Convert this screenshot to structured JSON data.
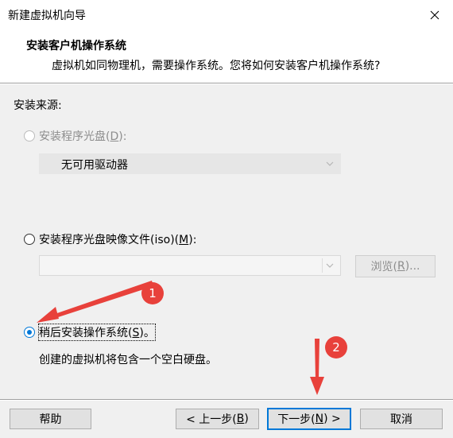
{
  "window": {
    "title": "新建虚拟机向导"
  },
  "header": {
    "title": "安装客户机操作系统",
    "subtitle": "虚拟机如同物理机，需要操作系统。您将如何安装客户机操作系统?"
  },
  "source": {
    "group_label": "安装来源:",
    "option_disc": {
      "text": "安装程序光盘(",
      "key": "D",
      "tail": "):",
      "state": "disabled"
    },
    "disc_combo": {
      "value": "无可用驱动器"
    },
    "option_iso": {
      "text": "安装程序光盘映像文件(iso)(",
      "key": "M",
      "tail": "):"
    },
    "iso_combo": {
      "value": ""
    },
    "browse": {
      "text": "浏览(",
      "key": "R",
      "tail": ")..."
    },
    "option_later": {
      "text": "稍后安装操作系统(",
      "key": "S",
      "tail": ")。",
      "checked": true
    },
    "description": "创建的虚拟机将包含一个空白硬盘。"
  },
  "footer": {
    "help": "帮助",
    "back": {
      "text": "< 上一步(",
      "key": "B",
      "tail": ")"
    },
    "next": {
      "text": "下一步(",
      "key": "N",
      "tail": ") >"
    },
    "cancel": "取消"
  },
  "annotations": {
    "badge_1": "1",
    "badge_2": "2",
    "color": "#e8413b"
  },
  "colors": {
    "accent": "#0078d7",
    "annotation": "#e8413b"
  }
}
